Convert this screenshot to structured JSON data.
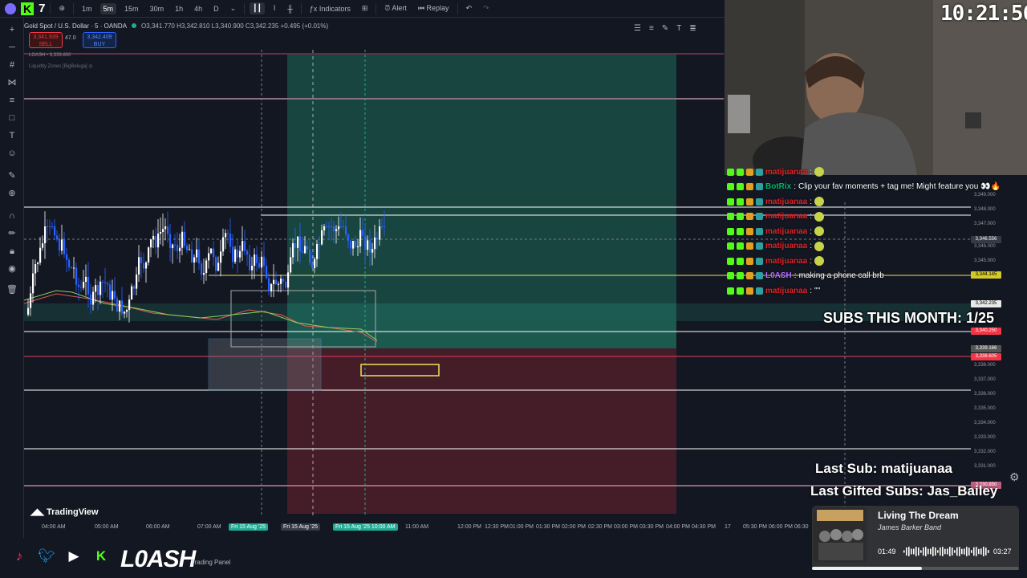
{
  "toolbar": {
    "channel_number": "7",
    "intervals": [
      "1m",
      "5m",
      "15m",
      "30m",
      "1h",
      "4h",
      "D"
    ],
    "active_interval": "5m",
    "indicators_label": "Indicators",
    "alert_label": "Alert",
    "replay_label": "Replay"
  },
  "symbol": {
    "title": "Gold Spot / U.S. Dollar · 5 · OANDA",
    "ohlc": "O3,341.770 H3,342.810 L3,340.900 C3,342.235 +0.495 (+0.01%)",
    "sell_price": "3,341.939",
    "sell_label": "SELL",
    "spread": "47.0",
    "buy_price": "3,342.409",
    "buy_label": "BUY",
    "overlay_1": "LOASH • 3,339.800",
    "overlay_2": "Liquidity Zones [BigBeluga]"
  },
  "price_axis": {
    "labels": [
      "3,349.000",
      "3,348.000",
      "3,347.000",
      "3,346.000",
      "3,345.000",
      "3,343.000",
      "3,342.000",
      "3,341.000",
      "3,338.000",
      "3,337.000",
      "3,336.000",
      "3,335.000",
      "3,334.000",
      "3,333.000",
      "3,332.000",
      "3,331.000"
    ],
    "tag_current": "3,346.556",
    "tag_yellow": "3,344.145",
    "tag_ohlc": "3,342.235",
    "tag_red": "3,340.250",
    "tag_gray": "3,339.166",
    "tag_red2": "3,338.605",
    "tag_bottom": "3,330.850"
  },
  "time_axis": {
    "labels": [
      "04:00 AM",
      "05:00 AM",
      "06:00 AM",
      "07:00 AM",
      "11:00 AM",
      "12:00 PM",
      "12:30 PM",
      "01:00 PM",
      "01:30 PM",
      "02:00 PM",
      "02:30 PM",
      "03:00 PM",
      "03:30 PM",
      "04:00 PM",
      "04:30 PM",
      "17",
      "05:30 PM",
      "06:00 PM",
      "06:30"
    ],
    "highlight_1": "Fri 15 Aug '25",
    "highlight_2": "Fri 15 Aug '25",
    "highlight_3": "Fri 15 Aug '25 10:00 AM"
  },
  "clock": "10:21:56",
  "chat": [
    {
      "user": "matijuanaa",
      "message": "",
      "color": "#e3232a",
      "emote": true
    },
    {
      "user": "BotRix",
      "message": "Clip your fav moments + tag me! Might feature you 👀🔥",
      "color": "#00b86b",
      "emote": false
    },
    {
      "user": "matijuanaa",
      "message": "",
      "color": "#e3232a",
      "emote": true
    },
    {
      "user": "matijuanaa",
      "message": "",
      "color": "#e3232a",
      "emote": true
    },
    {
      "user": "matijuanaa",
      "message": "",
      "color": "#e3232a",
      "emote": true
    },
    {
      "user": "matijuanaa",
      "message": "",
      "color": "#e3232a",
      "emote": true
    },
    {
      "user": "matijuanaa",
      "message": "",
      "color": "#e3232a",
      "emote": true
    },
    {
      "user": "L0ASH",
      "message": "making a phone call brb",
      "color": "#b46cff",
      "emote": false
    },
    {
      "user": "matijuanaa",
      "message": "\"\"",
      "color": "#e3232a",
      "emote": false
    }
  ],
  "overlay": {
    "subs_month": "SUBS THIS MONTH: 1/25",
    "last_sub": "Last Sub: matijuanaa",
    "last_gifted": "Last Gifted Subs: Jas_Bailey"
  },
  "music": {
    "song": "Living The Dream",
    "artist": "James Barker Band",
    "current": "01:49",
    "total": "03:27",
    "progress_fraction": 0.53
  },
  "footer": {
    "tradingview": "TradingView",
    "brand": "L0ASH",
    "trading_panel": "Trading Panel"
  },
  "colors": {
    "bg": "#131722",
    "green_zone": "#1e5e52",
    "red_zone": "#5a2230",
    "accent": "#2962ff"
  }
}
